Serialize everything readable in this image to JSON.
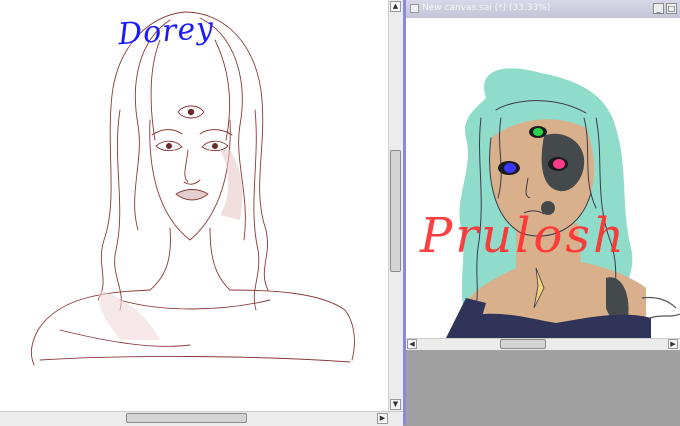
{
  "left_canvas": {
    "handwriting": "Dorey"
  },
  "right_window": {
    "title": "New canvas.sai (*) (33.33%)",
    "minimize_glyph": "_",
    "maximize_glyph": "□",
    "handwriting": "Prulosh"
  },
  "scroll": {
    "up_glyph": "▲",
    "down_glyph": "▼",
    "left_glyph": "◀",
    "right_glyph": "▶"
  },
  "colors": {
    "sketch_line": "#8a3838",
    "blue_ink": "#1a1aff",
    "red_ink": "#ff3030",
    "hair_mint": "#8fdccb",
    "skin": "#d9b08c",
    "window_border": "#8a8ad8"
  }
}
